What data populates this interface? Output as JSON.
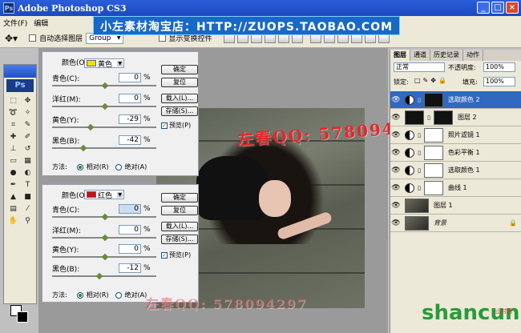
{
  "app": {
    "title": "Adobe Photoshop CS3",
    "logo": "Ps"
  },
  "window_buttons": [
    "_",
    "□",
    "×"
  ],
  "menu": [
    "文件(F)",
    "编辑"
  ],
  "banner": "小左素材淘宝店：HTTP://ZUOPS.TAOBAO.COM",
  "options_bar": {
    "auto_select_label": "自动选择图层",
    "auto_select_value": "Group",
    "show_transform_label": "显示变换控件"
  },
  "selective_color_top": {
    "color_label": "颜色(O):",
    "color_value": "黄色",
    "color_swatch": "#f0e000",
    "sliders": [
      {
        "label": "青色(C):",
        "value": "0",
        "unit": "%",
        "pos": 0.5
      },
      {
        "label": "洋红(M):",
        "value": "0",
        "unit": "%",
        "pos": 0.5
      },
      {
        "label": "黄色(Y):",
        "value": "-29",
        "unit": "%",
        "pos": 0.36
      },
      {
        "label": "黑色(B):",
        "value": "-42",
        "unit": "%",
        "pos": 0.29
      }
    ],
    "buttons": [
      "确定",
      "复位",
      "载入(L)...",
      "存储(S)..."
    ],
    "preview_label": "预览(P)",
    "method_label": "方法:",
    "method_options": [
      "相对(R)",
      "绝对(A)"
    ]
  },
  "selective_color_bottom": {
    "color_label": "颜色(O):",
    "color_value": "红色",
    "color_swatch": "#d01010",
    "sliders": [
      {
        "label": "青色(C):",
        "value": "0",
        "unit": "%",
        "pos": 0.5
      },
      {
        "label": "洋红(M):",
        "value": "0",
        "unit": "%",
        "pos": 0.5
      },
      {
        "label": "黄色(Y):",
        "value": "0",
        "unit": "%",
        "pos": 0.5
      },
      {
        "label": "黑色(B):",
        "value": "-12",
        "unit": "%",
        "pos": 0.44
      }
    ],
    "buttons": [
      "确定",
      "复位",
      "载入(L)...",
      "存储(S)..."
    ],
    "preview_label": "预览(P)",
    "method_label": "方法:",
    "method_options": [
      "相对(R)",
      "绝对(A)"
    ]
  },
  "watermarks": {
    "canvas_qq": "左春QQ: 578094297",
    "bottom_qq": "左春QQ: 578094297"
  },
  "layers_panel": {
    "tabs": [
      "图层",
      "通道",
      "历史记录",
      "动作"
    ],
    "blend_mode": "正常",
    "opacity_label": "不透明度:",
    "opacity_value": "100%",
    "lock_label": "锁定:",
    "fill_label": "填充:",
    "fill_value": "100%",
    "layers": [
      {
        "name": "选取颜色 2",
        "type": "adjustment",
        "mask": "dark",
        "selected": true
      },
      {
        "name": "图层 2",
        "type": "pixel",
        "mask": "dark",
        "selected": false
      },
      {
        "name": "照片滤镜 1",
        "type": "adjustment",
        "mask": "white",
        "selected": false
      },
      {
        "name": "色彩平衡 1",
        "type": "adjustment",
        "mask": "white",
        "selected": false
      },
      {
        "name": "选取颜色 1",
        "type": "adjustment",
        "mask": "white",
        "selected": false
      },
      {
        "name": "曲线 1",
        "type": "adjustment",
        "mask": "white",
        "selected": false
      },
      {
        "name": "图层 1",
        "type": "pixel",
        "mask": "none",
        "selected": false
      },
      {
        "name": "背景",
        "type": "background",
        "mask": "none",
        "selected": false
      }
    ]
  },
  "site_logo": {
    "text": "shancun",
    "sub": "山村网"
  }
}
